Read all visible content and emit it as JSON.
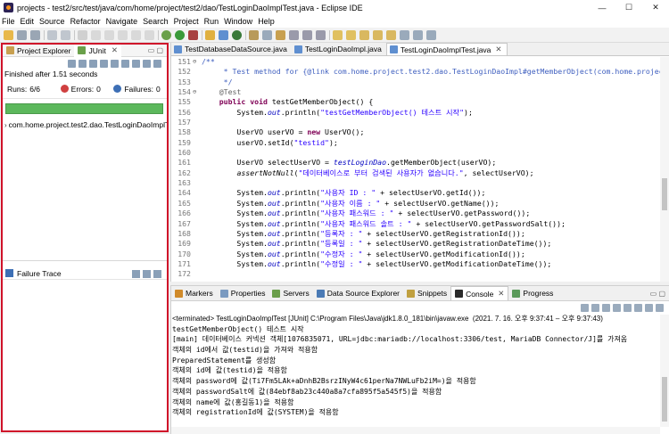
{
  "window": {
    "title": "projects - test2/src/test/java/com/home/project/test2/dao/TestLoginDaoImplTest.java - Eclipse IDE",
    "controls": [
      "—",
      "☐",
      "✕"
    ]
  },
  "menu": [
    "File",
    "Edit",
    "Source",
    "Refactor",
    "Navigate",
    "Search",
    "Project",
    "Run",
    "Window",
    "Help"
  ],
  "left_panel": {
    "tabs": [
      {
        "label": "Project Explorer"
      },
      {
        "label": "JUnit",
        "close": "✕"
      }
    ],
    "finished": "Finished after 1.51 seconds",
    "stats": {
      "runs_label": "Runs:",
      "runs_value": "6/6",
      "errors_label": "Errors:",
      "errors_value": "0",
      "failures_label": "Failures:",
      "failures_value": "0"
    },
    "progress": {
      "fraction": 1.0,
      "color": "#5cb85c"
    },
    "tree": [
      {
        "label": "com.home.project.test2.dao.TestLoginDaoImplT"
      }
    ],
    "failure_trace": "Failure Trace"
  },
  "editor": {
    "tabs": [
      {
        "label": "TestDatabaseDataSource.java"
      },
      {
        "label": "TestLoginDaoImpl.java"
      },
      {
        "label": "TestLoginDaoImplTest.java",
        "close": "✕"
      }
    ],
    "lines": [
      {
        "n": "151",
        "m": "⊖",
        "h": "<span class=\"cm\">/**</span>"
      },
      {
        "n": "152",
        "m": "",
        "h": "<span class=\"cm\">     * Test method for {@link com.home.project.test2.dao.TestLoginDaoImpl#getMemberObject(com.home.project</span>"
      },
      {
        "n": "153",
        "m": "",
        "h": "<span class=\"cm\">     */</span>"
      },
      {
        "n": "154",
        "m": "⊖",
        "h": "    <span class=\"ann\">@Test</span>"
      },
      {
        "n": "155",
        "m": "",
        "h": "    <span class=\"kw\">public void</span> testGetMemberObject() {"
      },
      {
        "n": "156",
        "m": "",
        "h": "        System.<span class=\"fld\">out</span>.println(<span class=\"str\">\"testGetMemberObject() 테스트 시작\"</span>);"
      },
      {
        "n": "157",
        "m": "",
        "h": ""
      },
      {
        "n": "158",
        "m": "",
        "h": "        UserVO userVO = <span class=\"kw\">new</span> UserVO();"
      },
      {
        "n": "159",
        "m": "",
        "h": "        userVO.setId(<span class=\"str\">\"testid\"</span>);"
      },
      {
        "n": "160",
        "m": "",
        "h": ""
      },
      {
        "n": "161",
        "m": "",
        "h": "        UserVO selectUserVO = <span class=\"fld\">testLoginDao</span>.getMemberObject(userVO);"
      },
      {
        "n": "162",
        "m": "",
        "h": "        <span class=\"it\">assertNotNull</span>(<span class=\"str\">\"데이터베이스로 부터 검색된 사용자가 없습니다.\"</span>, selectUserVO);"
      },
      {
        "n": "163",
        "m": "",
        "h": ""
      },
      {
        "n": "164",
        "m": "",
        "h": "        System.<span class=\"fld\">out</span>.println(<span class=\"str\">\"사용자 ID : \"</span> + selectUserVO.getId());"
      },
      {
        "n": "165",
        "m": "",
        "h": "        System.<span class=\"fld\">out</span>.println(<span class=\"str\">\"사용자 이름 : \"</span> + selectUserVO.getName());"
      },
      {
        "n": "166",
        "m": "",
        "h": "        System.<span class=\"fld\">out</span>.println(<span class=\"str\">\"사용자 패스워드 : \"</span> + selectUserVO.getPassword());"
      },
      {
        "n": "167",
        "m": "",
        "h": "        System.<span class=\"fld\">out</span>.println(<span class=\"str\">\"사용자 패스워드 솔트 : \"</span> + selectUserVO.getPasswordSalt());"
      },
      {
        "n": "168",
        "m": "",
        "h": "        System.<span class=\"fld\">out</span>.println(<span class=\"str\">\"등록자 : \"</span> + selectUserVO.getRegistrationId());"
      },
      {
        "n": "169",
        "m": "",
        "h": "        System.<span class=\"fld\">out</span>.println(<span class=\"str\">\"등록일 : \"</span> + selectUserVO.getRegistrationDateTime());"
      },
      {
        "n": "170",
        "m": "",
        "h": "        System.<span class=\"fld\">out</span>.println(<span class=\"str\">\"수정자 : \"</span> + selectUserVO.getModificationId());"
      },
      {
        "n": "171",
        "m": "",
        "h": "        System.<span class=\"fld\">out</span>.println(<span class=\"str\">\"수정일 : \"</span> + selectUserVO.getModificationDateTime());"
      },
      {
        "n": "172",
        "m": "",
        "h": ""
      }
    ]
  },
  "console": {
    "tabs": [
      {
        "label": "Markers",
        "color": "#d08a2a"
      },
      {
        "label": "Properties",
        "color": "#7a9ac0"
      },
      {
        "label": "Servers",
        "color": "#6a9e4a"
      },
      {
        "label": "Data Source Explorer",
        "color": "#4a7ab5"
      },
      {
        "label": "Snippets",
        "color": "#c0a040"
      },
      {
        "label": "Console",
        "color": "#2a2a2a",
        "active": true,
        "close": "✕"
      },
      {
        "label": "Progress",
        "color": "#5a9a5a"
      }
    ],
    "terminated": "<terminated> TestLoginDaoImplTest [JUnit] C:\\Program Files\\Java\\jdk1.8.0_181\\bin\\javaw.exe  (2021. 7. 16. 오후 9:37:41 – 오후 9:37:43)",
    "lines": [
      "testGetMemberObject() 테스트 시작",
      "[main] 데이터베이스 커넥션 객체[1076835071, URL=jdbc:mariadb://localhost:3306/test, MariaDB Connector/J]를 가져옴",
      "객체의 id에서 값(testid)을 가져와 적용함",
      "PreparedStatement를 생성함",
      "객체의 id에 값(testid)을 적용함",
      "객체의 password에 값(Ti7Fm5LAk+aDnhB2BsrzINyW4c61perNa7NWLuFb2iM=)을 적용함",
      "객체의 passwordSalt에 값(84ebf8ab23c440a8a7cfa895f5a545f5)을 적용함",
      "객체의 name에 값(홍길동1)을 적용함",
      "객체의 registrationId에 값(SYSTEM)을 적용함"
    ]
  }
}
